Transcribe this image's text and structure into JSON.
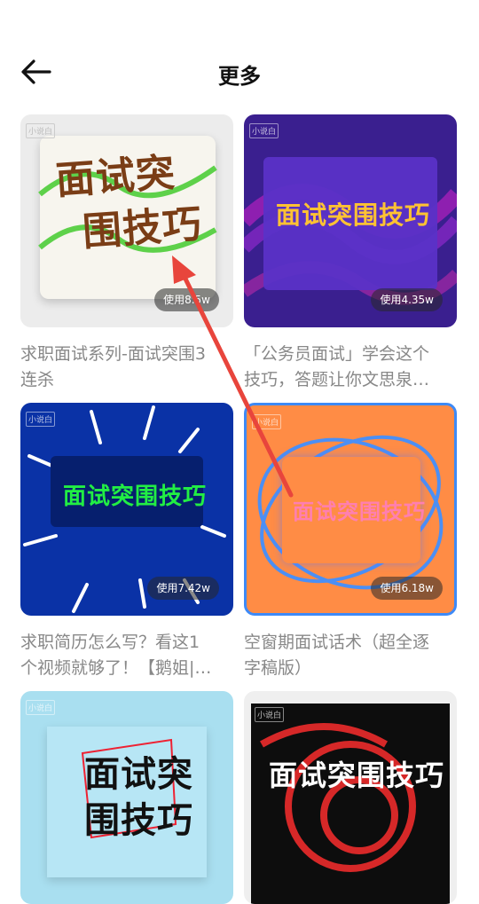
{
  "header": {
    "title": "更多"
  },
  "cards": [
    {
      "art_text": [
        "面试突",
        "围技巧"
      ],
      "badge": "使用8.5w",
      "title_l1": "求职面试系列-面试突围3",
      "title_l2": "连杀",
      "bg": "#efefef"
    },
    {
      "art_text": [
        "面试突围技巧"
      ],
      "badge": "使用4.35w",
      "title_l1": "「公务员面试」学会这个",
      "title_l2": "技巧，答题让你文思泉…",
      "bg": "#3a1f8f"
    },
    {
      "art_text": [
        "面试突围技巧"
      ],
      "badge": "使用7.42w",
      "title_l1": "求职简历怎么写？看这1",
      "title_l2": "个视频就够了！【鹅姐|…",
      "bg": "#0a32a6"
    },
    {
      "art_text": [
        "面试突围技巧"
      ],
      "badge": "使用6.18w",
      "title_l1": "空窗期面试话术（超全逐",
      "title_l2": "字稿版）",
      "bg": "#ff8c45"
    },
    {
      "art_text": [
        "面试突",
        "围技巧"
      ],
      "bg": "#a9dff0"
    },
    {
      "art_text": [
        "面试突围技巧"
      ],
      "bg": "#0d0d0d"
    }
  ],
  "watermark": "小说白"
}
